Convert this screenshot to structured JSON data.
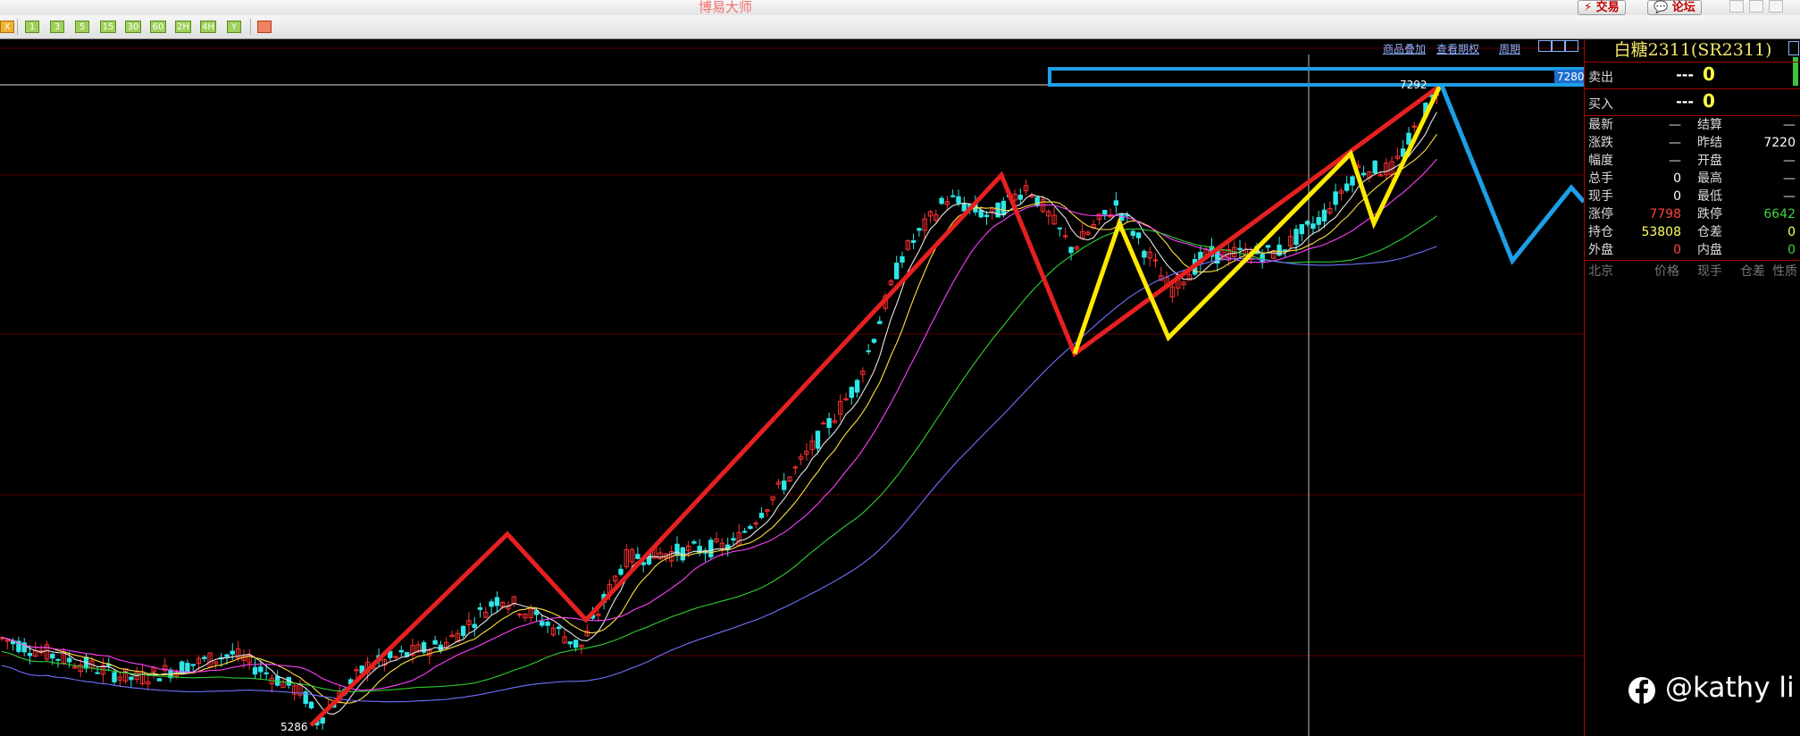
{
  "window": {
    "title": "博易大师",
    "buttons": {
      "trade": "⚡ 交易",
      "forum": "💬 论坛"
    }
  },
  "toolbar": {
    "periods": [
      "X",
      "1",
      "3",
      "5",
      "15",
      "30",
      "60",
      "2H",
      "4H",
      "Y"
    ]
  },
  "chart_links": {
    "overlay": "商品叠加",
    "options": "查看期权",
    "period": "周期"
  },
  "price_labels": {
    "high": "7292",
    "low": "5286",
    "cursor": "7280"
  },
  "quote": {
    "title": "白糖2311(SR2311)",
    "ask": {
      "label": "卖出",
      "price": "---",
      "qty": "0"
    },
    "bid": {
      "label": "买入",
      "price": "---",
      "qty": "0"
    },
    "rows": [
      {
        "l1": "最新",
        "v1": "—",
        "c1": "#dddddd",
        "l2": "结算",
        "v2": "—",
        "c2": "#dddddd"
      },
      {
        "l1": "涨跌",
        "v1": "—",
        "c1": "#dddddd",
        "l2": "昨结",
        "v2": "7220",
        "c2": "#ffffff"
      },
      {
        "l1": "幅度",
        "v1": "—",
        "c1": "#dddddd",
        "l2": "开盘",
        "v2": "—",
        "c2": "#dddddd"
      },
      {
        "l1": "总手",
        "v1": "0",
        "c1": "#ffffff",
        "l2": "最高",
        "v2": "—",
        "c2": "#dddddd"
      },
      {
        "l1": "现手",
        "v1": "0",
        "c1": "#ffffff",
        "l2": "最低",
        "v2": "—",
        "c2": "#dddddd"
      },
      {
        "l1": "涨停",
        "v1": "7798",
        "c1": "#ff4040",
        "l2": "跌停",
        "v2": "6642",
        "c2": "#40d040"
      },
      {
        "l1": "持仓",
        "v1": "53808",
        "c1": "#ffff60",
        "l2": "仓差",
        "v2": "0",
        "c2": "#ffff60"
      },
      {
        "l1": "外盘",
        "v1": "0",
        "c1": "#ff4040",
        "l2": "内盘",
        "v2": "0",
        "c2": "#40d040"
      }
    ],
    "tick_headers": [
      "北京",
      "价格",
      "现手",
      "仓差",
      "性质"
    ]
  },
  "watermark": {
    "text": "@kathy li"
  },
  "colors": {
    "up": "#ff3030",
    "down": "#2ee6e6",
    "red_line": "#e62020",
    "yellow_line": "#ffea00",
    "blue_line": "#1e9ee6"
  }
}
